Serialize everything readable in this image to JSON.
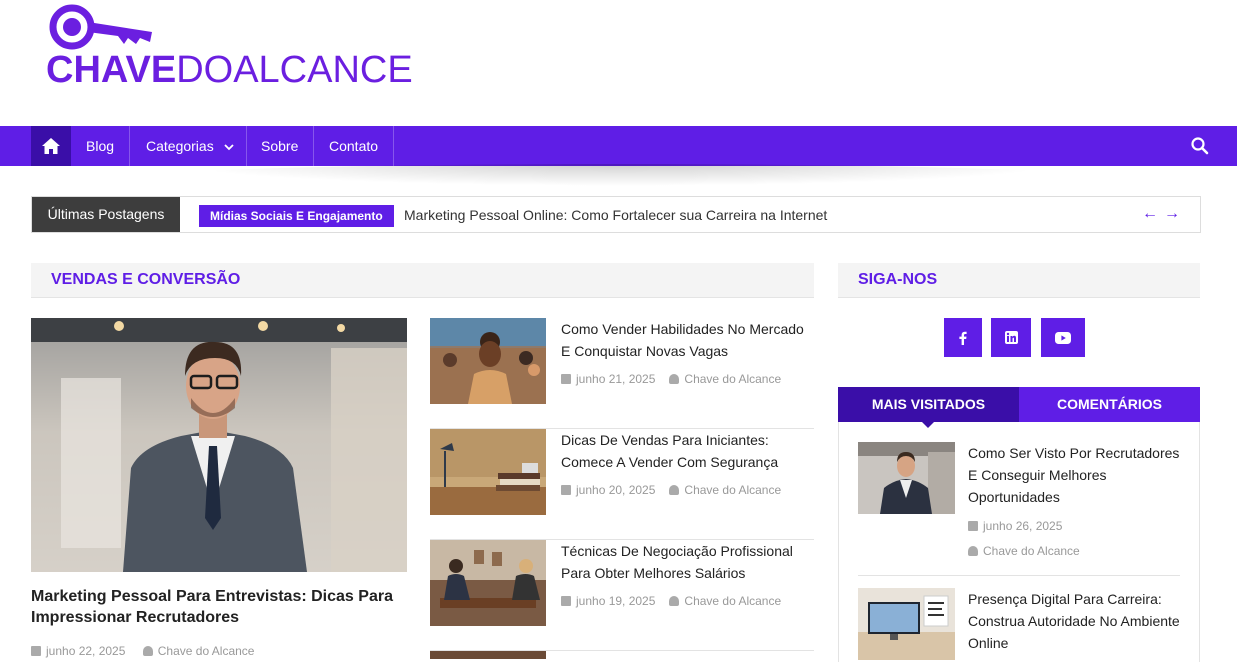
{
  "brand": {
    "name_bold": "CHAVE",
    "name_light": "DOALCANCE",
    "color": "#6b1fe0"
  },
  "nav": {
    "items": [
      {
        "label": "Blog"
      },
      {
        "label": "Categorias"
      },
      {
        "label": "Sobre"
      },
      {
        "label": "Contato"
      }
    ],
    "bg": "#5f1ee6"
  },
  "ticker": {
    "label": "Últimas Postagens",
    "badge": "Mídias Sociais E Engajamento",
    "headline": "Marketing Pessoal Online: Como Fortalecer sua Carreira na Internet"
  },
  "section": {
    "title": "VENDAS E CONVERSÃO",
    "hero": {
      "title": "Marketing Pessoal Para Entrevistas: Dicas Para Impressionar Recrutadores",
      "date": "junho 22, 2025",
      "author": "Chave do Alcance"
    },
    "posts": [
      {
        "title": "Como Vender Habilidades No Mercado E Conquistar Novas Vagas",
        "date": "junho 21, 2025",
        "author": "Chave do Alcance"
      },
      {
        "title": "Dicas De Vendas Para Iniciantes: Comece A Vender Com Segurança",
        "date": "junho 20, 2025",
        "author": "Chave do Alcance"
      },
      {
        "title": "Técnicas De Negociação Profissional Para Obter Melhores Salários",
        "date": "junho 19, 2025",
        "author": "Chave do Alcance"
      }
    ]
  },
  "sidebar": {
    "follow_title": "SIGA-NOS",
    "social": [
      "facebook-icon",
      "linkedin-icon",
      "youtube-icon"
    ],
    "tabs": [
      {
        "label": "MAIS VISITADOS"
      },
      {
        "label": "COMENTÁRIOS"
      }
    ],
    "posts": [
      {
        "title": "Como Ser Visto Por Recrutadores E Conseguir Melhores Oportunidades",
        "date": "junho 26, 2025",
        "author": "Chave do Alcance"
      },
      {
        "title": "Presença Digital Para Carreira: Construa Autoridade No Ambiente Online",
        "date": "",
        "author": ""
      }
    ]
  }
}
